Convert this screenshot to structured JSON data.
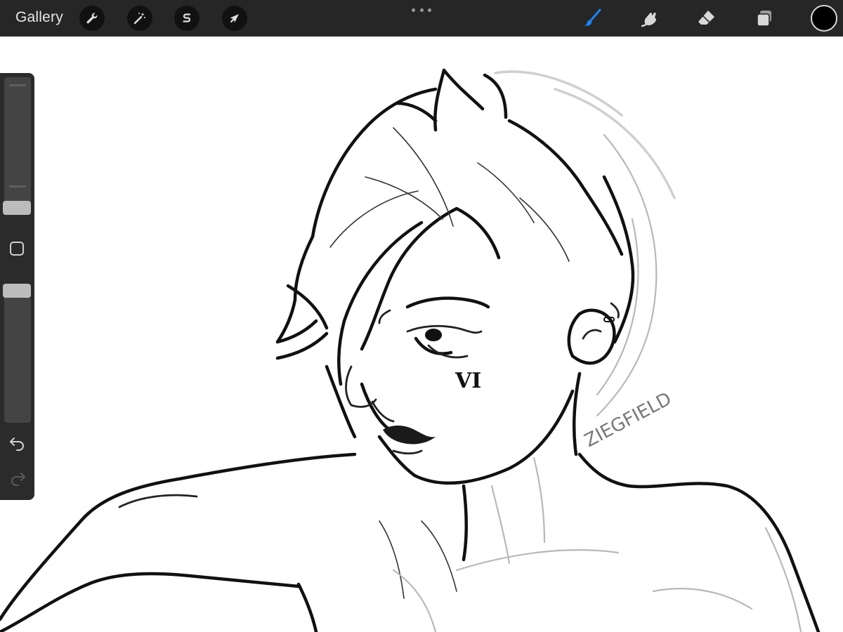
{
  "app": {
    "gallery_label": "Gallery"
  },
  "toolbar": {
    "left_tools": [
      {
        "name": "actions",
        "icon": "wrench-icon"
      },
      {
        "name": "adjustments",
        "icon": "magic-wand-icon"
      },
      {
        "name": "selection",
        "icon": "selection-s-icon"
      },
      {
        "name": "transform",
        "icon": "arrow-cursor-icon"
      }
    ],
    "right_tools": [
      {
        "name": "brush",
        "icon": "brush-icon",
        "active": true
      },
      {
        "name": "smudge",
        "icon": "smudge-icon",
        "active": false
      },
      {
        "name": "eraser",
        "icon": "eraser-icon",
        "active": false
      },
      {
        "name": "layers",
        "icon": "layers-icon",
        "active": false
      }
    ],
    "current_color": "#000000",
    "active_tool_color": "#1e82f0"
  },
  "sidebar": {
    "brush_size_icon": "brush-size-slider",
    "opacity_icon": "opacity-slider",
    "modify_icon": "square-modify-icon",
    "undo_icon": "undo-arrow-icon",
    "redo_icon": "redo-arrow-icon"
  },
  "canvas": {
    "background": "#ffffff",
    "face_mark": "VI",
    "signature": "ZIEGFIELD"
  }
}
